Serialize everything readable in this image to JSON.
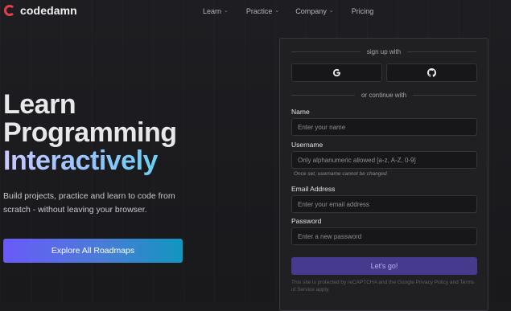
{
  "brand": {
    "name": "codedamn",
    "accent": "#e53e4a"
  },
  "nav": {
    "items": [
      {
        "label": "Learn",
        "has_dropdown": true
      },
      {
        "label": "Practice",
        "has_dropdown": true
      },
      {
        "label": "Company",
        "has_dropdown": true
      },
      {
        "label": "Pricing",
        "has_dropdown": false
      }
    ]
  },
  "hero": {
    "title_line1": "Learn",
    "title_line2": "Programming",
    "title_line3": "Interactively",
    "description": "Build projects, practice and learn to code from scratch - without leaving your browser.",
    "cta_label": "Explore All Roadmaps"
  },
  "signup": {
    "sign_up_with": "sign up with",
    "social": [
      {
        "provider": "Google",
        "icon": "google-icon"
      },
      {
        "provider": "GitHub",
        "icon": "github-icon"
      }
    ],
    "or_continue": "or continue with",
    "fields": {
      "name": {
        "label": "Name",
        "placeholder": "Enter your name"
      },
      "username": {
        "label": "Username",
        "placeholder": "Only alphanumeric allowed [a-z, A-Z, 0-9]",
        "hint": "Once set, username cannot be changed"
      },
      "email": {
        "label": "Email Address",
        "placeholder": "Enter your email address"
      },
      "password": {
        "label": "Password",
        "placeholder": "Enter a new password"
      }
    },
    "submit_label": "Let's go!",
    "legal": "This site is protected by reCAPTCHA and the Google Privacy Policy and Terms of Service apply."
  },
  "colors": {
    "background": "#1b1b1e",
    "card": "#202023",
    "cta_gradient_start": "#6a5af9",
    "cta_gradient_end": "#1196bf",
    "submit": "#463a8f"
  }
}
